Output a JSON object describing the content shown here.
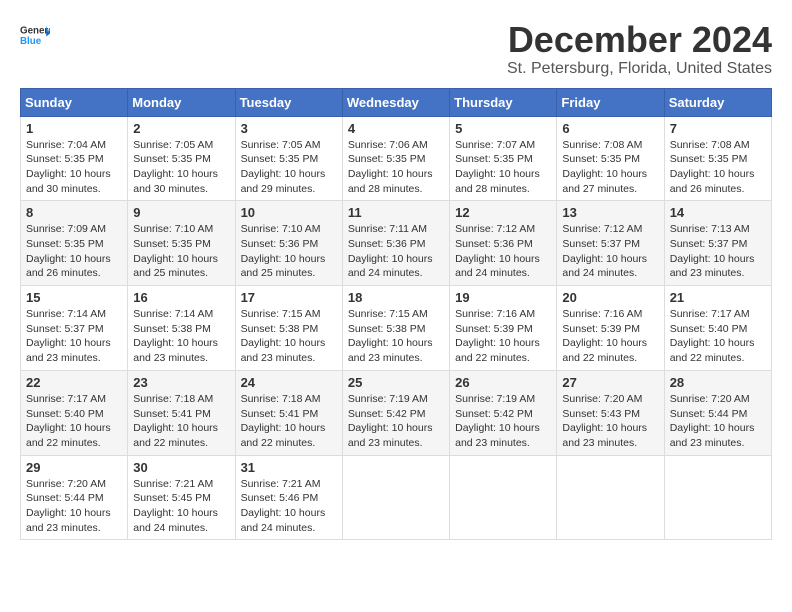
{
  "header": {
    "logo_general": "General",
    "logo_blue": "Blue",
    "title": "December 2024",
    "subtitle": "St. Petersburg, Florida, United States"
  },
  "weekdays": [
    "Sunday",
    "Monday",
    "Tuesday",
    "Wednesday",
    "Thursday",
    "Friday",
    "Saturday"
  ],
  "weeks": [
    [
      {
        "day": "1",
        "sunrise": "7:04 AM",
        "sunset": "5:35 PM",
        "daylight": "10 hours and 30 minutes."
      },
      {
        "day": "2",
        "sunrise": "7:05 AM",
        "sunset": "5:35 PM",
        "daylight": "10 hours and 30 minutes."
      },
      {
        "day": "3",
        "sunrise": "7:05 AM",
        "sunset": "5:35 PM",
        "daylight": "10 hours and 29 minutes."
      },
      {
        "day": "4",
        "sunrise": "7:06 AM",
        "sunset": "5:35 PM",
        "daylight": "10 hours and 28 minutes."
      },
      {
        "day": "5",
        "sunrise": "7:07 AM",
        "sunset": "5:35 PM",
        "daylight": "10 hours and 28 minutes."
      },
      {
        "day": "6",
        "sunrise": "7:08 AM",
        "sunset": "5:35 PM",
        "daylight": "10 hours and 27 minutes."
      },
      {
        "day": "7",
        "sunrise": "7:08 AM",
        "sunset": "5:35 PM",
        "daylight": "10 hours and 26 minutes."
      }
    ],
    [
      {
        "day": "8",
        "sunrise": "7:09 AM",
        "sunset": "5:35 PM",
        "daylight": "10 hours and 26 minutes."
      },
      {
        "day": "9",
        "sunrise": "7:10 AM",
        "sunset": "5:35 PM",
        "daylight": "10 hours and 25 minutes."
      },
      {
        "day": "10",
        "sunrise": "7:10 AM",
        "sunset": "5:36 PM",
        "daylight": "10 hours and 25 minutes."
      },
      {
        "day": "11",
        "sunrise": "7:11 AM",
        "sunset": "5:36 PM",
        "daylight": "10 hours and 24 minutes."
      },
      {
        "day": "12",
        "sunrise": "7:12 AM",
        "sunset": "5:36 PM",
        "daylight": "10 hours and 24 minutes."
      },
      {
        "day": "13",
        "sunrise": "7:12 AM",
        "sunset": "5:37 PM",
        "daylight": "10 hours and 24 minutes."
      },
      {
        "day": "14",
        "sunrise": "7:13 AM",
        "sunset": "5:37 PM",
        "daylight": "10 hours and 23 minutes."
      }
    ],
    [
      {
        "day": "15",
        "sunrise": "7:14 AM",
        "sunset": "5:37 PM",
        "daylight": "10 hours and 23 minutes."
      },
      {
        "day": "16",
        "sunrise": "7:14 AM",
        "sunset": "5:38 PM",
        "daylight": "10 hours and 23 minutes."
      },
      {
        "day": "17",
        "sunrise": "7:15 AM",
        "sunset": "5:38 PM",
        "daylight": "10 hours and 23 minutes."
      },
      {
        "day": "18",
        "sunrise": "7:15 AM",
        "sunset": "5:38 PM",
        "daylight": "10 hours and 23 minutes."
      },
      {
        "day": "19",
        "sunrise": "7:16 AM",
        "sunset": "5:39 PM",
        "daylight": "10 hours and 22 minutes."
      },
      {
        "day": "20",
        "sunrise": "7:16 AM",
        "sunset": "5:39 PM",
        "daylight": "10 hours and 22 minutes."
      },
      {
        "day": "21",
        "sunrise": "7:17 AM",
        "sunset": "5:40 PM",
        "daylight": "10 hours and 22 minutes."
      }
    ],
    [
      {
        "day": "22",
        "sunrise": "7:17 AM",
        "sunset": "5:40 PM",
        "daylight": "10 hours and 22 minutes."
      },
      {
        "day": "23",
        "sunrise": "7:18 AM",
        "sunset": "5:41 PM",
        "daylight": "10 hours and 22 minutes."
      },
      {
        "day": "24",
        "sunrise": "7:18 AM",
        "sunset": "5:41 PM",
        "daylight": "10 hours and 22 minutes."
      },
      {
        "day": "25",
        "sunrise": "7:19 AM",
        "sunset": "5:42 PM",
        "daylight": "10 hours and 23 minutes."
      },
      {
        "day": "26",
        "sunrise": "7:19 AM",
        "sunset": "5:42 PM",
        "daylight": "10 hours and 23 minutes."
      },
      {
        "day": "27",
        "sunrise": "7:20 AM",
        "sunset": "5:43 PM",
        "daylight": "10 hours and 23 minutes."
      },
      {
        "day": "28",
        "sunrise": "7:20 AM",
        "sunset": "5:44 PM",
        "daylight": "10 hours and 23 minutes."
      }
    ],
    [
      {
        "day": "29",
        "sunrise": "7:20 AM",
        "sunset": "5:44 PM",
        "daylight": "10 hours and 23 minutes."
      },
      {
        "day": "30",
        "sunrise": "7:21 AM",
        "sunset": "5:45 PM",
        "daylight": "10 hours and 24 minutes."
      },
      {
        "day": "31",
        "sunrise": "7:21 AM",
        "sunset": "5:46 PM",
        "daylight": "10 hours and 24 minutes."
      },
      null,
      null,
      null,
      null
    ]
  ]
}
